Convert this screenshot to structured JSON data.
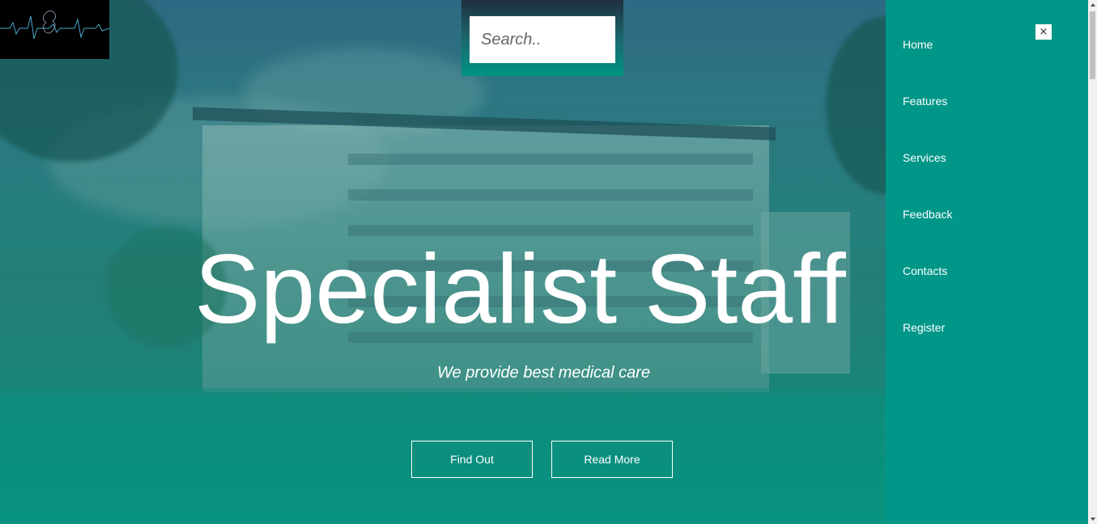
{
  "search": {
    "placeholder": "Search.."
  },
  "hero": {
    "title": "Specialist Staff",
    "subtitle": "We provide best medical care",
    "buttons": {
      "find_out": "Find Out",
      "read_more": "Read More"
    }
  },
  "sidenav": {
    "close_label": "×",
    "items": [
      {
        "label": "Home"
      },
      {
        "label": "Features"
      },
      {
        "label": "Services"
      },
      {
        "label": "Feedback"
      },
      {
        "label": "Contacts"
      },
      {
        "label": "Register"
      }
    ]
  },
  "colors": {
    "accent": "#009688",
    "hero_overlay": "#0b8c7e",
    "text": "#ffffff"
  },
  "icons": {
    "logo": "heartbeat-logo-icon",
    "close": "close-icon"
  }
}
